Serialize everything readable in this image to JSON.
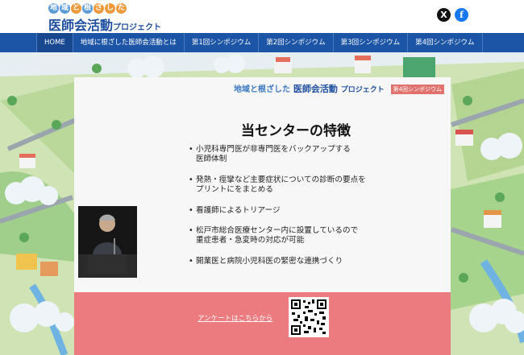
{
  "header": {
    "logo_line1_chars": [
      "地",
      "域",
      "と",
      "根",
      "ざ",
      "し",
      "た"
    ],
    "logo_line2": "医師会活動",
    "logo_line2_suffix": "プロジェクト",
    "social": {
      "x_label": "X",
      "facebook_label": "f"
    }
  },
  "nav": {
    "items": [
      {
        "label": "HOME",
        "active": true
      },
      {
        "label": "地域に根ざした医師会活動とは",
        "active": false
      },
      {
        "label": "第1回シンポジウム",
        "active": false
      },
      {
        "label": "第2回シンポジウム",
        "active": false
      },
      {
        "label": "第3回シンポジウム",
        "active": false
      },
      {
        "label": "第4回シンポジウム",
        "active": false
      }
    ]
  },
  "slide": {
    "logo_line1": "地域と根ざした",
    "logo_line2": "医師会活動",
    "logo_suffix": "プロジェクト",
    "badge": "第4回シンポジウム",
    "title": "当センターの特徴",
    "bullets": [
      {
        "line1": "小児科専門医が非専門医をバックアップする",
        "line2": "医師体制"
      },
      {
        "line1": "発熱・痙攣など主要症状についての診断の要点を",
        "line2": "プリントにをまとめる"
      },
      {
        "line1": "看護師によるトリアージ",
        "line2": ""
      },
      {
        "line1": "松戸市総合医療センター内に設置しているので",
        "line2": "重症患者・急変時の対応が可能"
      },
      {
        "line1": "開業医と病院小児科医の緊密な連携づくり",
        "line2": ""
      }
    ]
  },
  "survey": {
    "link_text": "アンケートはこちらから"
  },
  "colors": {
    "nav_bg": "#1d55a6",
    "band_bg": "#ec7b80",
    "brand_blue": "#1e4e9e"
  }
}
